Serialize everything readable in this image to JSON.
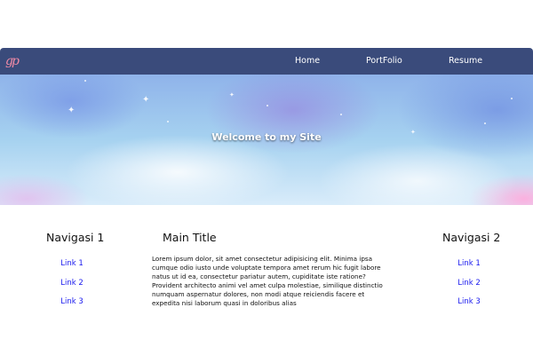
{
  "navbar": {
    "logo_text": "gp",
    "links": [
      "Home",
      "PortFolio",
      "Resume"
    ],
    "background": "#3a4b7b"
  },
  "hero": {
    "title": "Welcome to my Site"
  },
  "left_nav": {
    "heading": "Navigasi 1",
    "links": [
      "Link 1",
      "Link 2",
      "Link 3"
    ]
  },
  "main": {
    "heading": "Main Title",
    "body": "Lorem ipsum dolor, sit amet consectetur adipisicing elit. Minima ipsa cumque odio iusto unde voluptate tempora amet rerum hic fugit labore natus ut id ea, consectetur pariatur autem, cupiditate iste ratione? Provident architecto animi vel amet culpa molestiae, similique distinctio numquam aspernatur dolores, non modi atque reiciendis facere et expedita nisi laborum quasi in doloribus alias"
  },
  "right_nav": {
    "heading": "Navigasi 2",
    "links": [
      "Link 1",
      "Link 2",
      "Link 3"
    ]
  },
  "colors": {
    "link": "#1a1aee",
    "logo": "#f08aa6"
  }
}
